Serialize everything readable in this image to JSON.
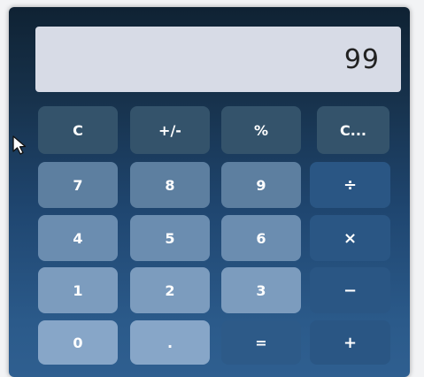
{
  "display": {
    "value": "99"
  },
  "keys": {
    "row1": [
      "C",
      "+/-",
      "%",
      "C..."
    ],
    "row2": [
      "7",
      "8",
      "9",
      "÷"
    ],
    "row3": [
      "4",
      "5",
      "6",
      "×"
    ],
    "row4": [
      "1",
      "2",
      "3",
      "−"
    ],
    "row5": [
      "0",
      ".",
      "=",
      "+"
    ]
  },
  "icons": {
    "cursor": "mouse-pointer-icon"
  },
  "colors": {
    "display_bg": "#d7dbe6",
    "panel_dark": "#0f2233",
    "operator_key": "#2a5684"
  }
}
